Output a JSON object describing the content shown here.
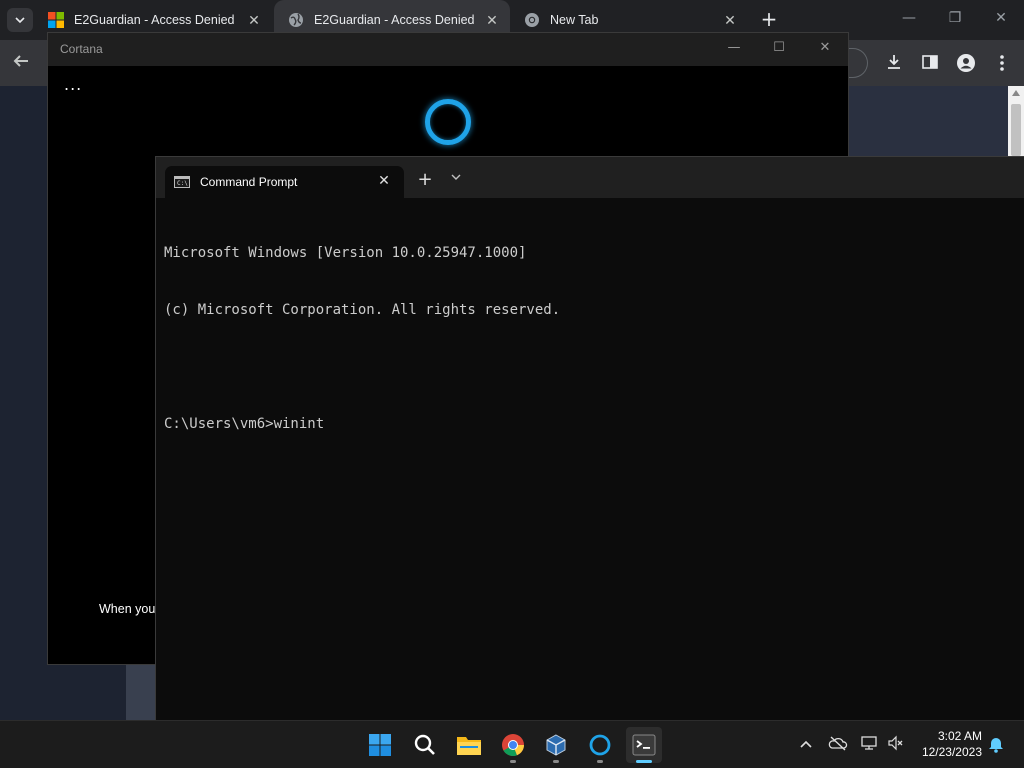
{
  "browser": {
    "tabs": [
      {
        "title": "E2Guardian - Access Denied",
        "active": false
      },
      {
        "title": "E2Guardian - Access Denied",
        "active": true
      },
      {
        "title": "New Tab",
        "active": false
      }
    ],
    "new_tab_label": "+",
    "close_glyph": "✕"
  },
  "cortana": {
    "title": "Cortana",
    "dots": "...",
    "hint_text": "When you'",
    "accent_color": "#1fa3e8"
  },
  "terminal": {
    "tab_title": "Command Prompt",
    "tab_icon_text": "C:\\",
    "lines": [
      "Microsoft Windows [Version 10.0.25947.1000]",
      "(c) Microsoft Corporation. All rights reserved.",
      "",
      "C:\\Users\\vm6>winint"
    ]
  },
  "taskbar": {
    "apps": [
      "start-icon",
      "search-icon",
      "file-explorer-icon",
      "chrome-icon",
      "virtualbox-icon",
      "cortana-icon",
      "terminal-icon"
    ],
    "time": "3:02 AM",
    "date": "12/23/2023"
  }
}
